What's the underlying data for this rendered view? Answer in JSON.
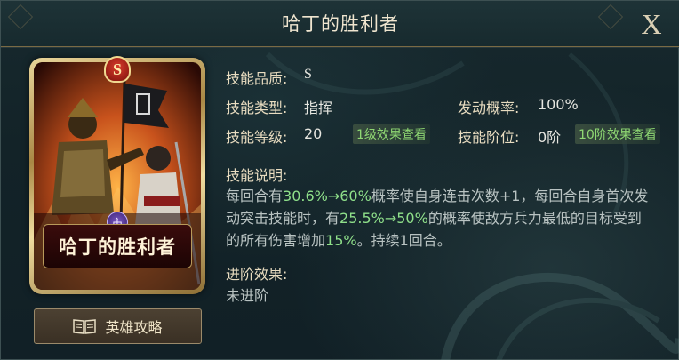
{
  "header": {
    "title": "哈丁的胜利者",
    "close_label": "X"
  },
  "card": {
    "grade": "S",
    "name": "哈丁的胜利者",
    "faction_glyph": "市"
  },
  "guide_button": {
    "label": "英雄攻略",
    "icon": "book-icon"
  },
  "info": {
    "quality_label": "技能品质:",
    "quality_value": "S",
    "type_label": "技能类型:",
    "type_value": "指挥",
    "chance_label": "发动概率:",
    "chance_value": "100%",
    "level_label": "技能等级:",
    "level_value": "20",
    "level_link": "1级效果查看",
    "rank_label": "技能阶位:",
    "rank_value": "0阶",
    "rank_link": "10阶效果查看"
  },
  "description": {
    "label": "技能说明:",
    "p1": "每回合有",
    "v1": "30.6%→60%",
    "p2": "概率使自身连击次数+1，每回合自身首次发动突击技能时，有",
    "v2": "25.5%→50%",
    "p3": "的概率使敌方兵力最低的目标受到的所有伤害增加",
    "v3": "15%",
    "p4": "。持续1回合。"
  },
  "advance": {
    "label": "进阶效果:",
    "value": "未进阶"
  },
  "colors": {
    "highlight": "#8fe08a",
    "link": "#8fd873",
    "gold": "#c9a85a"
  }
}
